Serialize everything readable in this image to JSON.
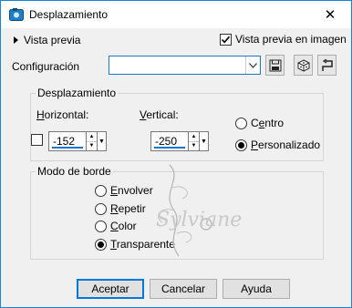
{
  "window": {
    "title": "Desplazamiento",
    "close_glyph": "✕"
  },
  "preview": {
    "toggle_label": "Vista previa",
    "live_label": "Vista previa en imagen",
    "live_checked": true
  },
  "config": {
    "label": "Configuración",
    "value": "",
    "icons": [
      "save-icon",
      "random-dice-icon",
      "reset-icon"
    ]
  },
  "offset": {
    "group_title": "Desplazamiento",
    "horizontal_label": "Horizontal:",
    "vertical_label": "Vertical:",
    "horizontal_value": "-152",
    "vertical_value": "-250",
    "link_checked": false,
    "center_label": "Centro",
    "custom_label": "Personalizado",
    "selected": "custom"
  },
  "edge_mode": {
    "group_title": "Modo de borde",
    "options": [
      "Envolver",
      "Repetir",
      "Color",
      "Transparente"
    ],
    "selected": "Transparente"
  },
  "buttons": {
    "ok": "Aceptar",
    "cancel": "Cancelar",
    "help": "Ayuda"
  },
  "watermark_text": "Sylviane",
  "colors": {
    "accent": "#1979ca",
    "window_bg": "#f0f0f0",
    "default_button_border": "#0078d7"
  }
}
